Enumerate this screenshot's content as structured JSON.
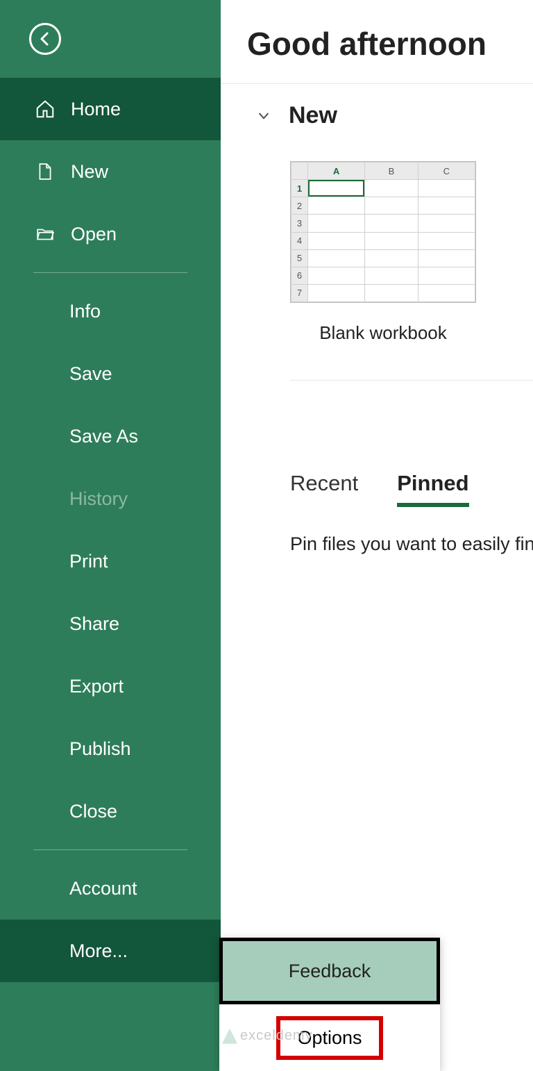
{
  "sidebar": {
    "home": "Home",
    "new": "New",
    "open": "Open",
    "info": "Info",
    "save": "Save",
    "saveas": "Save As",
    "history": "History",
    "print": "Print",
    "share": "Share",
    "export": "Export",
    "publish": "Publish",
    "close": "Close",
    "account": "Account",
    "more": "More..."
  },
  "main": {
    "greeting": "Good afternoon",
    "new_label": "New",
    "template_name": "Blank workbook",
    "tabs": {
      "recent": "Recent",
      "pinned": "Pinned"
    },
    "pin_message": "Pin files you want to easily find",
    "thumb": {
      "colA": "A",
      "colB": "B",
      "colC": "C"
    }
  },
  "popup": {
    "feedback": "Feedback",
    "options": "Options"
  },
  "watermark": "exceldemy"
}
